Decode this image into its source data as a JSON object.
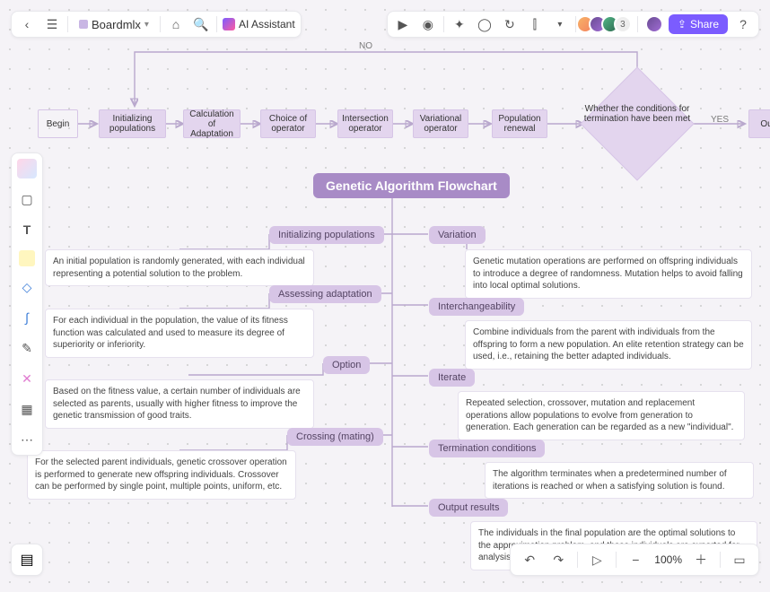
{
  "app": {
    "brand": "Boardmlx",
    "ai_label": "AI Assistant",
    "avatar_extra": "3",
    "share": "Share",
    "zoom": "100%"
  },
  "edges": {
    "no": "NO",
    "yes": "YES"
  },
  "row": {
    "begin": "Begin",
    "init": "Initializing populations",
    "calc": "Calculation of Adaptation",
    "choice": "Choice of operator",
    "intersect": "Intersection operator",
    "variational": "Variational operator",
    "renewal": "Population renewal",
    "diamond": "Whether the conditions for termination have been met",
    "out": "Ou"
  },
  "title": "Genetic Algorithm Flowchart",
  "left": {
    "pill1": "Initializing populations",
    "desc1": "An initial population is randomly generated, with each individual representing a potential solution to the problem.",
    "pill2": "Assessing adaptation",
    "desc2": "For each individual in the population, the value of its fitness function was calculated and used to measure its degree of superiority or inferiority.",
    "pill3": "Option",
    "desc3": "Based on the fitness value, a certain number of individuals are selected as parents, usually with higher fitness to improve the genetic transmission of good traits.",
    "pill4": "Crossing (mating)",
    "desc4": "For the selected parent individuals, genetic crossover operation is performed to generate new offspring individuals. Crossover can be performed by single point, multiple points, uniform, etc."
  },
  "right": {
    "pill1": "Variation",
    "desc1": "Genetic mutation operations are performed on offspring individuals to introduce a degree of randomness. Mutation helps to avoid falling into local optimal solutions.",
    "pill2": "Interchangeability",
    "desc2": "Combine individuals from the parent with individuals from the offspring to form a new population. An elite retention strategy can be used, i.e., retaining the better adapted individuals.",
    "pill3": "Iterate",
    "desc3": "Repeated selection, crossover, mutation and replacement operations allow populations to evolve from generation to generation. Each generation can be regarded as a new \"individual\".",
    "pill4": "Termination conditions",
    "desc4": "The algorithm terminates when a predetermined number of iterations is reached or when a satisfying solution is found.",
    "pill5": "Output results",
    "desc5": "The individuals in the final population are the optimal solutions to the approximation problem, and these individuals are exported for analysis and application."
  }
}
